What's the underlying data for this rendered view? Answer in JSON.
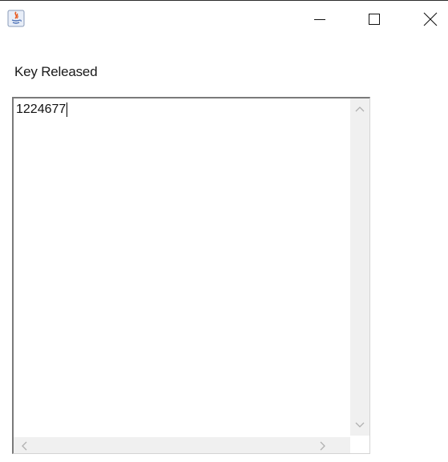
{
  "window": {
    "title": "",
    "icon": "java-icon",
    "controls": {
      "minimize": "minimize-icon",
      "maximize": "maximize-icon",
      "close": "close-icon"
    }
  },
  "main": {
    "event_label": "Key Released",
    "text_area": {
      "value": "1224677"
    }
  }
}
